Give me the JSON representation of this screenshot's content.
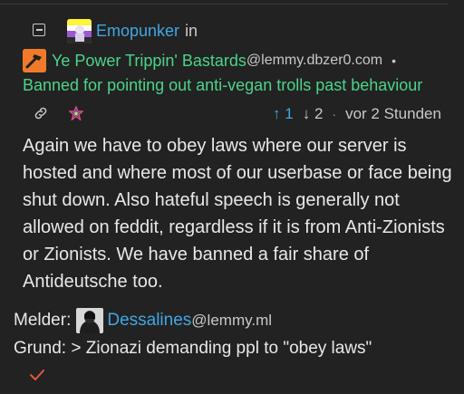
{
  "comment": {
    "author": {
      "name": "Emopunker",
      "in_label": "in",
      "avatar_icon": "nonbinary-flag-avatar"
    },
    "community": {
      "name": "Ye Power Trippin' Bastards",
      "host": "@lemmy.dbzer0.com",
      "separator": "•",
      "icon": "community-icon"
    },
    "title": "Banned for pointing out anti-vegan trolls past behaviour",
    "actions": {
      "link_icon": "link-icon",
      "instance_icon": "instance-star-icon",
      "upvotes": "1",
      "downvotes": "2",
      "upvote_arrow": "↑",
      "downvote_arrow": "↓",
      "separator": "·",
      "time_ago": "vor 2 Stunden"
    },
    "body": [
      "Again we have to obey laws where our server is",
      "hosted and where most of our userbase or face being",
      "shut down. Also hateful speech is generally not",
      "allowed on feddit, regardless if it is from Anti-Zionists",
      "or Zionists. We have banned a fair share of",
      "Antideutsche too."
    ]
  },
  "report": {
    "reporter_label": "Melder:",
    "reporter_name": "Dessalines",
    "reporter_host": "@lemmy.ml",
    "reason": "Grund: > Zionazi demanding ppl to \"obey laws\"",
    "resolve_icon": "check-icon"
  },
  "colors": {
    "background": "#222222",
    "link_blue": "#3fa8e5",
    "community_green": "#4cd489",
    "text": "#e8e8e8"
  }
}
